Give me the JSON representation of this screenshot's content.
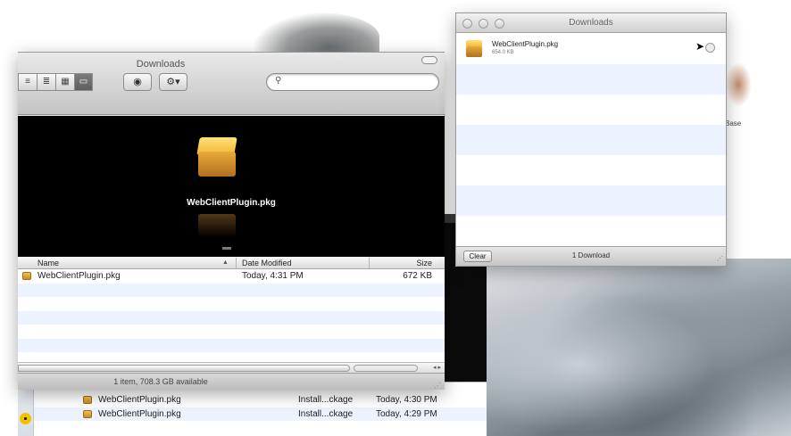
{
  "desktop": {
    "top_text": "",
    "side_text": "Base"
  },
  "back_list": {
    "rows": [
      {
        "name": "WebClientPlugin.pkg",
        "kind": "Install...ckage",
        "date": "Today, 4:30 PM"
      },
      {
        "name": "WebClientPlugin.pkg",
        "kind": "Install...ckage",
        "date": "Today, 4:29 PM"
      }
    ]
  },
  "finder": {
    "title": "Downloads",
    "view_buttons": [
      "≡",
      "≣",
      "▦",
      "▭"
    ],
    "quicklook_icon": "eye-icon",
    "action_icon": "gear-icon",
    "action_label": "⚙▾",
    "search_placeholder": "",
    "coverflow_label": "WebClientPlugin.pkg",
    "columns": {
      "name": "Name",
      "date": "Date Modified",
      "size": "Size"
    },
    "files": [
      {
        "name": "WebClientPlugin.pkg",
        "date": "Today, 4:31 PM",
        "size": "672 KB"
      }
    ],
    "status": "1 item, 708.3 GB available"
  },
  "downloads_window": {
    "title": "Downloads",
    "items": [
      {
        "name": "WebClientPlugin.pkg",
        "size": "654.0 KB"
      }
    ],
    "clear_label": "Clear",
    "count": "1 Download"
  }
}
